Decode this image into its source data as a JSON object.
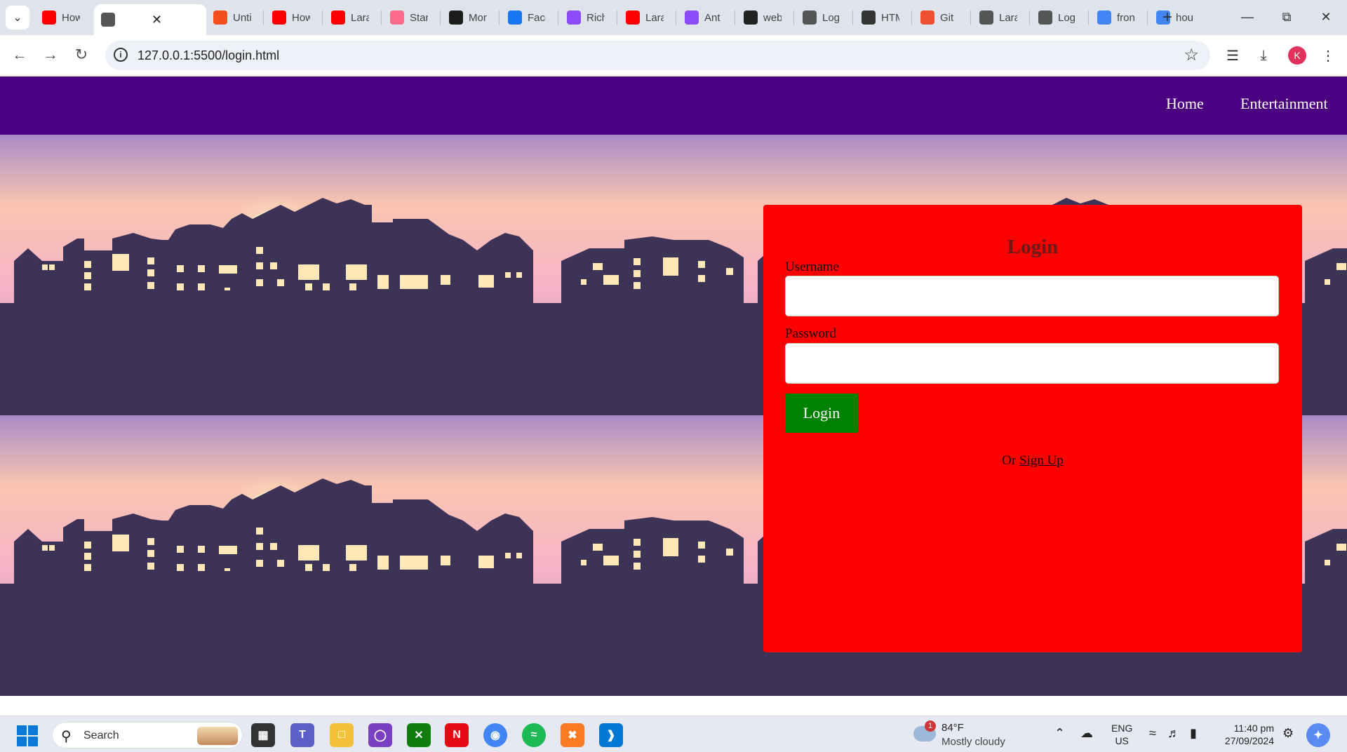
{
  "browser": {
    "tabs": [
      {
        "title": "How",
        "icon": "youtube-icon",
        "color": "#ff0000"
      },
      {
        "title": "",
        "icon": "globe-icon",
        "color": "#555555",
        "active": true
      },
      {
        "title": "Untitled",
        "icon": "figma-icon",
        "color": "#f24e1e"
      },
      {
        "title": "How",
        "icon": "youtube-icon",
        "color": "#ff0000"
      },
      {
        "title": "Laravel",
        "icon": "youtube-icon",
        "color": "#ff0000"
      },
      {
        "title": "Start",
        "icon": "laravel-icon",
        "color": "#ff6b8a"
      },
      {
        "title": "Mon",
        "icon": "mt-icon",
        "color": "#1c1c1c"
      },
      {
        "title": "Face",
        "icon": "facebook-icon",
        "color": "#1877f2"
      },
      {
        "title": "Rich",
        "icon": "messenger-icon",
        "color": "#8b4cf7"
      },
      {
        "title": "Lara",
        "icon": "youtube-icon",
        "color": "#ff0000"
      },
      {
        "title": "Ant",
        "icon": "messenger-icon",
        "color": "#8b4cf7"
      },
      {
        "title": "web",
        "icon": "github-icon",
        "color": "#222222"
      },
      {
        "title": "Log",
        "icon": "globe-icon",
        "color": "#555555"
      },
      {
        "title": "HTM",
        "icon": "openai-icon",
        "color": "#333333"
      },
      {
        "title": "Git",
        "icon": "git-icon",
        "color": "#f05032"
      },
      {
        "title": "Lara",
        "icon": "globe-icon",
        "color": "#555555"
      },
      {
        "title": "Log",
        "icon": "globe-icon",
        "color": "#555555"
      },
      {
        "title": "fron",
        "icon": "google-icon",
        "color": "#4285f4"
      },
      {
        "title": "hou",
        "icon": "google-icon",
        "color": "#4285f4"
      }
    ],
    "url": "127.0.0.1:5500/login.html",
    "profile_initial": "K"
  },
  "site": {
    "nav": {
      "home": "Home",
      "entertainment": "Entertainment"
    },
    "login": {
      "title": "Login",
      "username_label": "Username",
      "password_label": "Password",
      "button": "Login",
      "signup_prefix": "Or",
      "signup_link": "Sign Up"
    },
    "colors": {
      "nav_bg": "#4b0082",
      "card_bg": "#ff0000",
      "button_bg": "#008000"
    }
  },
  "taskbar": {
    "search": "Search",
    "weather": {
      "badge": "1",
      "temp": "84°F",
      "condition": "Mostly cloudy"
    },
    "lang": {
      "line1": "ENG",
      "line2": "US"
    },
    "time": "11:40 pm",
    "date": "27/09/2024"
  }
}
